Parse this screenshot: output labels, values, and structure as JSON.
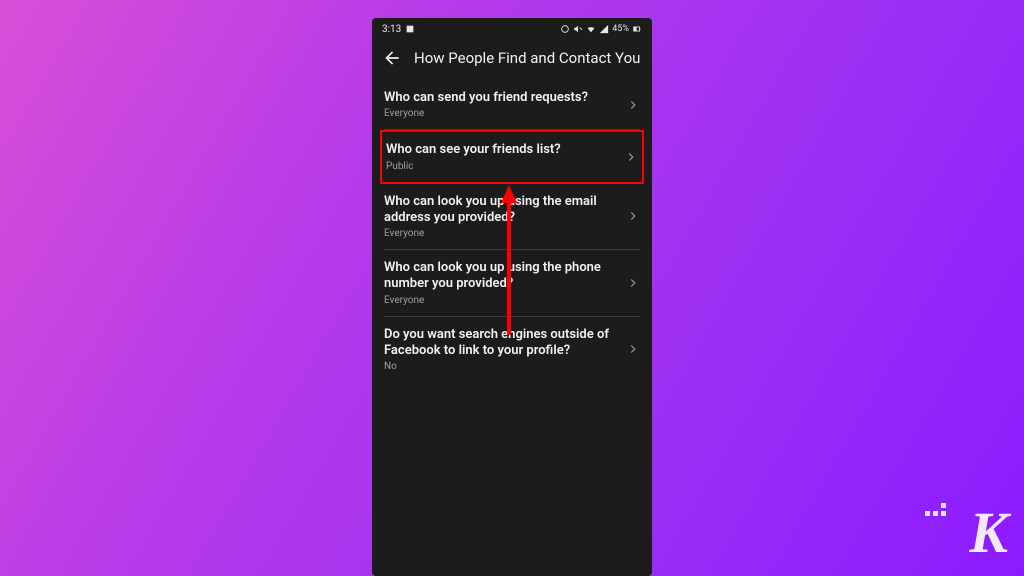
{
  "statusbar": {
    "time": "3:13",
    "battery": "45%"
  },
  "header": {
    "title": "How People Find and Contact You"
  },
  "settings": [
    {
      "title": "Who can send you friend requests?",
      "value": "Everyone",
      "highlighted": false
    },
    {
      "title": "Who can see your friends list?",
      "value": "Public",
      "highlighted": true
    },
    {
      "title": "Who can look you up using the email address you provided?",
      "value": "Everyone",
      "highlighted": false
    },
    {
      "title": "Who can look you up using the phone number you provided?",
      "value": "Everyone",
      "highlighted": false
    },
    {
      "title": "Do you want search engines outside of Facebook to link to your profile?",
      "value": "No",
      "highlighted": false
    }
  ],
  "branding": {
    "logo_letter": "K"
  }
}
